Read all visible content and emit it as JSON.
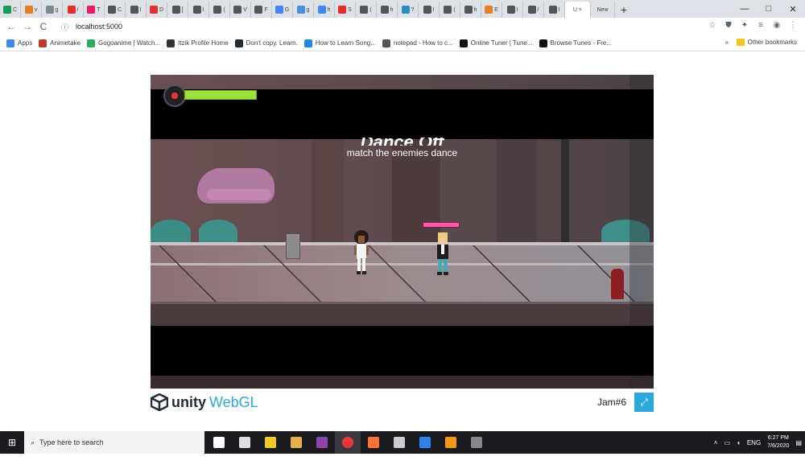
{
  "browser": {
    "tabs": [
      {
        "color": "#0f9d58",
        "label": "C"
      },
      {
        "color": "#e67e22",
        "label": "v"
      },
      {
        "color": "#7f8c8d",
        "label": "g"
      },
      {
        "color": "#e52d27",
        "label": "/"
      },
      {
        "color": "#e91e63",
        "label": "T"
      },
      {
        "color": "#555555",
        "label": "C"
      },
      {
        "color": "#555555",
        "label": "I"
      },
      {
        "color": "#d33",
        "label": "D"
      },
      {
        "color": "#555555",
        "label": "["
      },
      {
        "color": "#555555",
        "label": "I"
      },
      {
        "color": "#555555",
        "label": "("
      },
      {
        "color": "#555555",
        "label": "V"
      },
      {
        "color": "#555555",
        "label": "F"
      },
      {
        "color": "#4285f4",
        "label": "G"
      },
      {
        "color": "#4a90e2",
        "label": "g"
      },
      {
        "color": "#4285f4",
        "label": "h"
      },
      {
        "color": "#e52d27",
        "label": "S"
      },
      {
        "color": "#555555",
        "label": "("
      },
      {
        "color": "#555555",
        "label": "h"
      },
      {
        "color": "#2c8ebb",
        "label": "?"
      },
      {
        "color": "#555555",
        "label": "I"
      },
      {
        "color": "#555555",
        "label": "("
      },
      {
        "color": "#555555",
        "label": "h"
      },
      {
        "color": "#e67e22",
        "label": "E"
      },
      {
        "color": "#555555",
        "label": "I"
      },
      {
        "color": "#555555",
        "label": "/"
      },
      {
        "color": "#555555",
        "label": "I"
      }
    ],
    "active_tab": {
      "label": "U",
      "close": "×"
    },
    "new_tab_label": "New",
    "new_tab_button": "+",
    "window_controls": {
      "minimize": "—",
      "maximize": "□",
      "close": "✕"
    },
    "nav": {
      "back": "←",
      "forward": "→",
      "reload": "C"
    },
    "url": "localhost:5000",
    "info_icon": "ⓘ",
    "toolbar_icons": [
      "☆",
      "⛊",
      "✦",
      "≡",
      "◉",
      "⋮"
    ],
    "bookmarks": [
      {
        "label": "Apps",
        "color": "#4285f4"
      },
      {
        "label": "Animetake",
        "color": "#c0392b"
      },
      {
        "label": "Gogoanime | Watch...",
        "color": "#27ae60"
      },
      {
        "label": "Itzik Profile Home",
        "color": "#333333"
      },
      {
        "label": "Don't copy. Learn.",
        "color": "#24292e"
      },
      {
        "label": "How to Learn Song...",
        "color": "#1e88e5"
      },
      {
        "label": "notepad - How to c...",
        "color": "#555555"
      },
      {
        "label": "Online Tuner | Tune...",
        "color": "#111111"
      },
      {
        "label": "Browse Tunes - Fre...",
        "color": "#111111"
      }
    ],
    "bookmarks_overflow": "»",
    "other_bookmarks": "Other bookmarks"
  },
  "game": {
    "title": "Dance Off",
    "subtitle": "match the enemies dance"
  },
  "footer": {
    "unity_label": "unity",
    "webgl_label": "WebGL",
    "project_title": "Jam#6",
    "fullscreen_icon": "⤢"
  },
  "taskbar": {
    "start_icon": "⊞",
    "search_placeholder": "Type here to search",
    "apps": [
      {
        "name": "task-view",
        "color": "#ffffff"
      },
      {
        "name": "snip",
        "color": "#dddddd"
      },
      {
        "name": "file-explorer",
        "color": "#f3c623"
      },
      {
        "name": "media-player",
        "color": "#e8b04a"
      },
      {
        "name": "photos",
        "color": "#8e44ad"
      },
      {
        "name": "chrome",
        "color": "#e53935"
      },
      {
        "name": "firefox",
        "color": "#ff7139"
      },
      {
        "name": "unity",
        "color": "#cccccc"
      },
      {
        "name": "vscode",
        "color": "#2f80ed"
      },
      {
        "name": "git",
        "color": "#f39c12"
      },
      {
        "name": "terminal",
        "color": "#888888"
      }
    ],
    "language": "ENG",
    "time": "6:27 PM",
    "date": "7/6/2020"
  }
}
